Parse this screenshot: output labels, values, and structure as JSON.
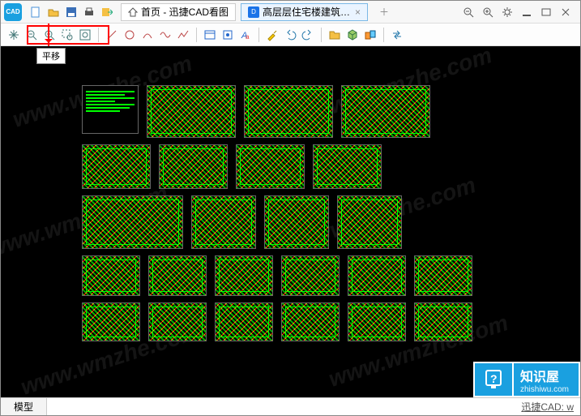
{
  "titlebar": {
    "home_tab": "首页 - 迅捷CAD看图",
    "file_tab": "高层层住宅楼建筑…"
  },
  "tooltip": {
    "pan": "平移"
  },
  "watermark": "www.wmzhe.com",
  "statusbar": {
    "model_tab": "模型",
    "right_text": "迅捷CAD: w"
  },
  "brand": {
    "title": "知识屋",
    "subtitle": "zhishiwu.com"
  },
  "icons": {
    "new": "new-icon",
    "open": "open-icon",
    "save": "save-icon",
    "print": "print-icon",
    "export": "export-icon",
    "home": "home-icon",
    "pan": "pan-icon",
    "zoom-out": "zoom-out-icon",
    "zoom-in": "zoom-in-icon",
    "zoom-window": "zoom-window-icon",
    "zoom-extents": "zoom-extents-icon",
    "line": "line-icon",
    "circle": "circle-icon",
    "arc": "arc-icon",
    "wave": "wave-icon",
    "polyline": "polyline-icon",
    "layer": "layer-icon",
    "snap": "snap-icon",
    "text": "text-tool-icon",
    "pipette": "pipette-icon",
    "undo": "undo-icon",
    "redo": "redo-icon",
    "folder": "folder-icon",
    "cube": "cube-icon",
    "group": "group-icon",
    "transfer": "transfer-icon",
    "mag-minus": "magnify-minus-icon",
    "mag-plus": "magnify-plus-icon",
    "gear": "gear-icon",
    "min": "minimize-icon",
    "max": "maximize-icon",
    "close": "close-icon"
  }
}
